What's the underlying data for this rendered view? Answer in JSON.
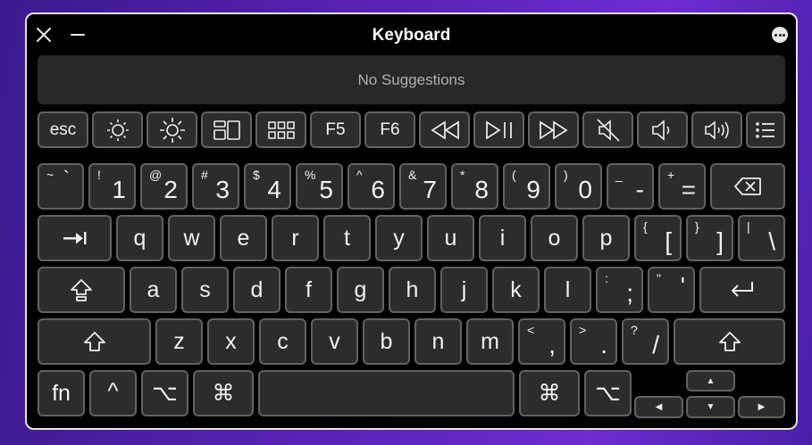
{
  "window": {
    "title": "Keyboard",
    "suggestion_text": "No Suggestions"
  },
  "icons": {
    "close": "close-icon",
    "minimize": "minimize-icon",
    "more": "more-options-icon"
  },
  "rows": {
    "function": [
      {
        "label": "esc"
      },
      {
        "icon": "brightness-down-icon"
      },
      {
        "icon": "brightness-up-icon"
      },
      {
        "icon": "mission-control-icon"
      },
      {
        "icon": "launchpad-icon"
      },
      {
        "label": "F5"
      },
      {
        "label": "F6"
      },
      {
        "icon": "rewind-icon"
      },
      {
        "icon": "play-pause-icon"
      },
      {
        "icon": "fast-forward-icon"
      },
      {
        "icon": "mute-icon"
      },
      {
        "icon": "volume-down-icon"
      },
      {
        "icon": "volume-up-icon"
      },
      {
        "icon": "list-icon"
      }
    ],
    "number": [
      {
        "main": "`",
        "shift": "~"
      },
      {
        "main": "1",
        "shift": "!"
      },
      {
        "main": "2",
        "shift": "@"
      },
      {
        "main": "3",
        "shift": "#"
      },
      {
        "main": "4",
        "shift": "$"
      },
      {
        "main": "5",
        "shift": "%"
      },
      {
        "main": "6",
        "shift": "^"
      },
      {
        "main": "7",
        "shift": "&"
      },
      {
        "main": "8",
        "shift": "*"
      },
      {
        "main": "9",
        "shift": "("
      },
      {
        "main": "0",
        "shift": ")"
      },
      {
        "main": "-",
        "shift": "_"
      },
      {
        "main": "=",
        "shift": "+"
      },
      {
        "icon": "delete-icon"
      }
    ],
    "top": [
      {
        "icon": "tab-icon"
      },
      {
        "main": "q"
      },
      {
        "main": "w"
      },
      {
        "main": "e"
      },
      {
        "main": "r"
      },
      {
        "main": "t"
      },
      {
        "main": "y"
      },
      {
        "main": "u"
      },
      {
        "main": "i"
      },
      {
        "main": "o"
      },
      {
        "main": "p"
      },
      {
        "main": "[",
        "shift": "{"
      },
      {
        "main": "]",
        "shift": "}"
      },
      {
        "main": "\\",
        "shift": "|"
      }
    ],
    "home": [
      {
        "icon": "caps-lock-icon"
      },
      {
        "main": "a"
      },
      {
        "main": "s"
      },
      {
        "main": "d"
      },
      {
        "main": "f"
      },
      {
        "main": "g"
      },
      {
        "main": "h"
      },
      {
        "main": "j"
      },
      {
        "main": "k"
      },
      {
        "main": "l"
      },
      {
        "main": ";",
        "shift": ":"
      },
      {
        "main": "'",
        "shift": "\""
      },
      {
        "icon": "return-icon"
      }
    ],
    "bottom": [
      {
        "icon": "shift-icon"
      },
      {
        "main": "z"
      },
      {
        "main": "x"
      },
      {
        "main": "c"
      },
      {
        "main": "v"
      },
      {
        "main": "b"
      },
      {
        "main": "n"
      },
      {
        "main": "m"
      },
      {
        "main": ",",
        "shift": "<"
      },
      {
        "main": ".",
        "shift": ">"
      },
      {
        "main": "/",
        "shift": "?"
      },
      {
        "icon": "shift-icon"
      }
    ],
    "modifier": [
      {
        "label": "fn"
      },
      {
        "main": "^"
      },
      {
        "main": "⌥"
      },
      {
        "main": "⌘"
      },
      {
        "icon": "space-bar"
      },
      {
        "main": "⌘"
      },
      {
        "main": "⌥"
      }
    ],
    "arrows": {
      "up": "▲",
      "left": "◀",
      "down": "▼",
      "right": "▶"
    }
  }
}
